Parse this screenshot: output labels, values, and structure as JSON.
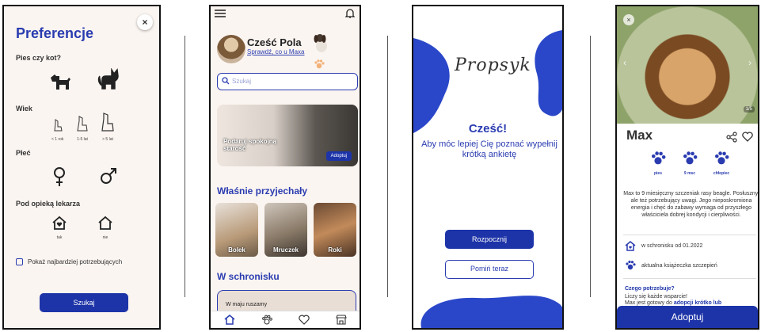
{
  "screen1": {
    "title": "Preferencje",
    "q_pet": "Pies czy kot?",
    "q_age": "Wiek",
    "ages": [
      "< 1 rok",
      "1-5 lat",
      "> 5 lat"
    ],
    "q_sex": "Płeć",
    "q_vet": "Pod opieką lekarza",
    "vet_yes": "tak",
    "vet_no": "nie",
    "checkbox_label": "Pokaż najbardziej potrzebujących",
    "search_button": "Szukaj",
    "close": "×"
  },
  "screen2": {
    "greeting": "Cześć Pola",
    "subtitle": "Sprawdź, co u Maxa",
    "search_placeholder": "Szukaj",
    "banner_text": "Podaruj spokojną starość",
    "banner_button": "Adoptuj",
    "section_new": "Właśnie przyjechały",
    "animals": [
      "Bolek",
      "Mruczek",
      "Roki"
    ],
    "section_shelter": "W schronisku",
    "shelter_text": "W maju ruszamy"
  },
  "screen3": {
    "logo": "Propsyk",
    "hello": "Cześć!",
    "message": "Aby móc lepiej Cię poznać wypełnij krótką ankietę",
    "start_button": "Rozpocznij",
    "skip_button": "Pomiń teraz"
  },
  "screen4": {
    "close": "×",
    "counter": "1/5",
    "name": "Max",
    "traits": [
      "pies",
      "9 msc",
      "chłopiec"
    ],
    "description": "Max to 9 miesięczny szczeniak rasy beagle. Posłuszny, ale też potrzebujący uwagi. Jego nieposkromiona energia i chęć do zabawy wymaga od przyszłego właściciela dobrej kondycji i cierpliwości.",
    "shelter_since": "w schronisku od 01.2022",
    "vaccination": "aktualna książeczka szczepień",
    "needs_title": "Czego potrzebuje?",
    "needs_line1": "Liczy się każde wsparcie!",
    "needs_line2_start": "Max jest gotowy do",
    "needs_line2_bold": "adopcji krótko lub",
    "adopt_button": "Adoptuj"
  },
  "colors": {
    "primary": "#1d34a8",
    "accent": "#2a3cb0",
    "paw": "#f2b27a",
    "bg": "#fbf5f1"
  }
}
